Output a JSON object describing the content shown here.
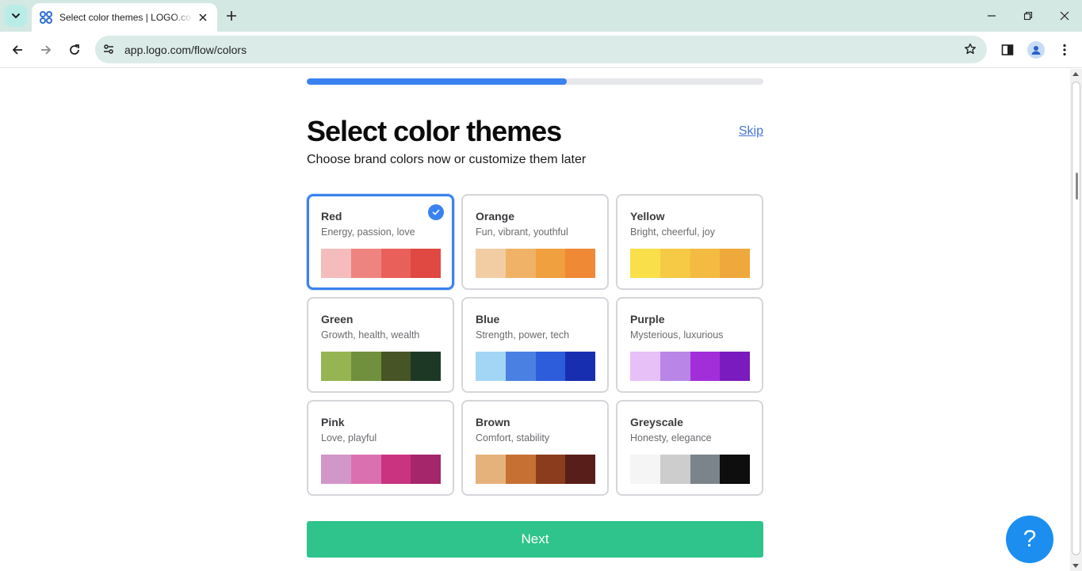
{
  "browser": {
    "tab_title": "Select color themes | LOGO.com",
    "url": "app.logo.com/flow/colors"
  },
  "progress": {
    "fraction": 0.57
  },
  "page": {
    "title": "Select color themes",
    "skip_label": "Skip",
    "subtitle": "Choose brand colors now or customize them later",
    "next_label": "Next",
    "help_label": "?"
  },
  "themes": [
    {
      "name": "Red",
      "desc": "Energy, passion, love",
      "selected": true,
      "colors": [
        "#f4bcbc",
        "#ee8480",
        "#e9605a",
        "#df4942"
      ]
    },
    {
      "name": "Orange",
      "desc": "Fun, vibrant, youthful",
      "selected": false,
      "colors": [
        "#f2cda4",
        "#f0b266",
        "#f0a03e",
        "#ef8935"
      ]
    },
    {
      "name": "Yellow",
      "desc": "Bright, cheerful, joy",
      "selected": false,
      "colors": [
        "#f9e04a",
        "#f6ca44",
        "#f4bb42",
        "#efa83b"
      ]
    },
    {
      "name": "Green",
      "desc": "Growth, health, wealth",
      "selected": false,
      "colors": [
        "#96b452",
        "#71903e",
        "#475425",
        "#1d3926"
      ]
    },
    {
      "name": "Blue",
      "desc": "Strength, power, tech",
      "selected": false,
      "colors": [
        "#a3d6f4",
        "#4a80e1",
        "#2d5ddb",
        "#182eb0"
      ]
    },
    {
      "name": "Purple",
      "desc": "Mysterious, luxurious",
      "selected": false,
      "colors": [
        "#e7c0f8",
        "#b985e6",
        "#a22ed9",
        "#7a1bbf"
      ]
    },
    {
      "name": "Pink",
      "desc": "Love, playful",
      "selected": false,
      "colors": [
        "#d396c8",
        "#db70b1",
        "#c9337f",
        "#a6266b"
      ]
    },
    {
      "name": "Brown",
      "desc": "Comfort, stability",
      "selected": false,
      "colors": [
        "#e6b27c",
        "#c67034",
        "#8b3c1c",
        "#581e19"
      ]
    },
    {
      "name": "Greyscale",
      "desc": "Honesty, elegance",
      "selected": false,
      "colors": [
        "#f5f5f5",
        "#cdcdcd",
        "#7b838b",
        "#0e0e0e"
      ]
    }
  ]
}
